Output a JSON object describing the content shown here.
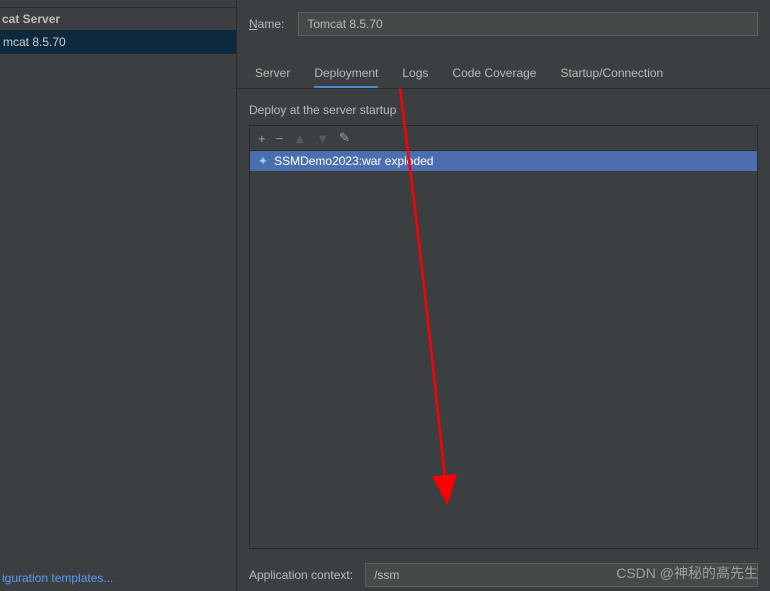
{
  "sidebar": {
    "header": "cat Server",
    "items": [
      "mcat 8.5.70"
    ],
    "templates_link": "iguration templates..."
  },
  "name": {
    "label_prefix": "N",
    "label_rest": "ame:",
    "value": "Tomcat 8.5.70"
  },
  "tabs": [
    "Server",
    "Deployment",
    "Logs",
    "Code Coverage",
    "Startup/Connection"
  ],
  "active_tab": 1,
  "deploy": {
    "heading": "Deploy at the server startup",
    "artifact": "SSMDemo2023:war exploded"
  },
  "context": {
    "label": "Application context:",
    "value": "/ssm"
  },
  "watermark": "CSDN @神秘的高先生"
}
